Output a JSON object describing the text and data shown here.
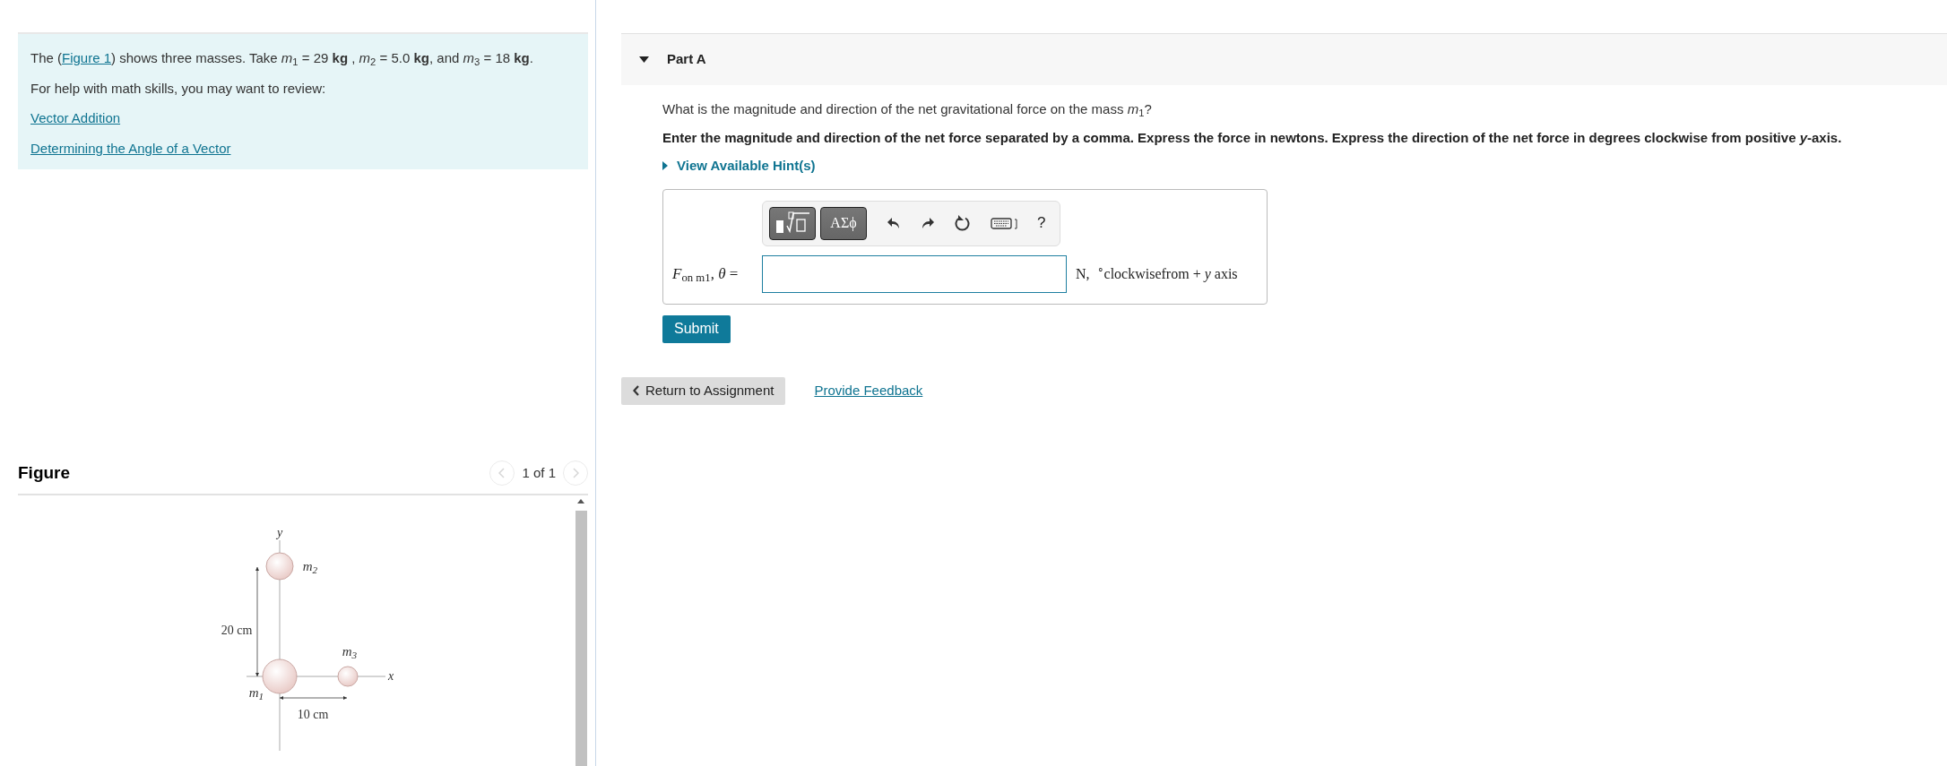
{
  "intro": {
    "before": "The (",
    "link": "Figure 1",
    "after": ") shows three masses. Take *m*$_{1}$ = 29 **kg** , *m*$_{2}$ = 5.0 **kg**, and *m*$_{3}$ = 18 **kg**."
  },
  "help_text": "For help with math skills, you may want to review:",
  "review_links": [
    "Vector Addition",
    "Determining the Angle of a Vector"
  ],
  "figure": {
    "title": "Figure",
    "pager": "1 of 1",
    "prev_disabled": true,
    "next_disabled": true,
    "labels": {
      "y_axis": "y",
      "x_axis": "x",
      "m1": "m$_{1}$",
      "m2": "m$_{2}$",
      "m3": "m$_{3}$",
      "vertical_distance": "20 cm",
      "horizontal_distance": "10 cm"
    }
  },
  "part": {
    "title": "Part A",
    "expanded": true,
    "question": "What is the magnitude and direction of the net gravitational force on the mass *m*$_{1}$?",
    "instructions": "Enter the magnitude and direction of the net force separated by a comma. Express the force in newtons. Express the direction of the net force in degrees clockwise from positive *y*-axis.",
    "hint": {
      "label": "View Available Hint(s)",
      "expanded": false
    },
    "toolbar": {
      "symbols": "ΑΣϕ",
      "help": "?"
    },
    "answer": {
      "label": "*F*$_{on m1}$, *θ* =",
      "units": "N,  $^{∘}$clockwisefrom + *y* axis"
    },
    "submit": "Submit"
  },
  "footer": {
    "return": "Return to Assignment",
    "feedback": "Provide Feedback"
  }
}
